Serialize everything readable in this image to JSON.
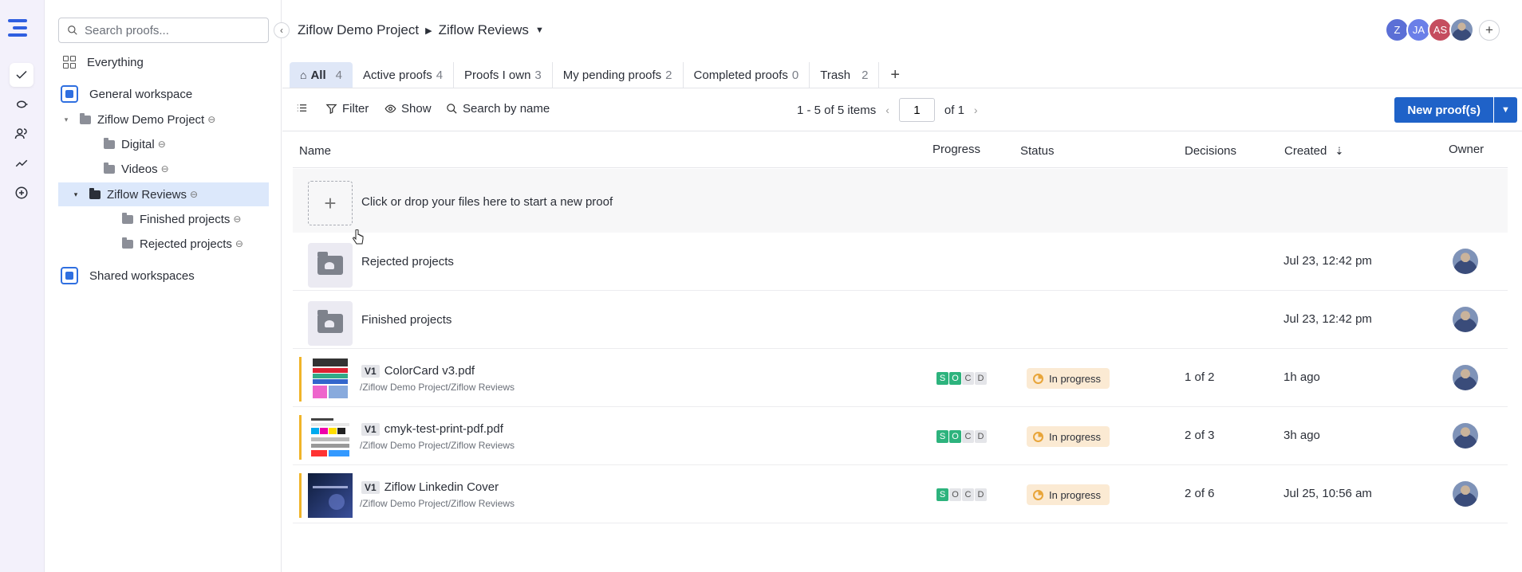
{
  "sidebar": {
    "search_placeholder": "Search proofs...",
    "everything": "Everything",
    "general_workspace": "General workspace",
    "project": "Ziflow Demo Project",
    "folders": [
      "Digital",
      "Videos"
    ],
    "selected_folder": "Ziflow Reviews",
    "subfolders": [
      "Finished projects",
      "Rejected projects"
    ],
    "shared_workspaces": "Shared workspaces"
  },
  "header": {
    "breadcrumb_project": "Ziflow Demo Project",
    "breadcrumb_folder": "Ziflow Reviews",
    "avatars": [
      {
        "initials": "Z",
        "color": "#5b6fd6"
      },
      {
        "initials": "JA",
        "color": "#6b7fe8"
      },
      {
        "initials": "AS",
        "color": "#c54d5f"
      }
    ]
  },
  "tabs": [
    {
      "label": "All",
      "count": "4"
    },
    {
      "label": "Active proofs",
      "count": "4"
    },
    {
      "label": "Proofs I own",
      "count": "3"
    },
    {
      "label": "My pending proofs",
      "count": "2"
    },
    {
      "label": "Completed proofs",
      "count": "0"
    },
    {
      "label": "Trash",
      "count": "2"
    }
  ],
  "toolbar": {
    "filter": "Filter",
    "show": "Show",
    "search": "Search by name",
    "items_range": "1 - 5 of 5 items",
    "page": "1",
    "of_pages": "of 1",
    "new_proof": "New proof(s)"
  },
  "table": {
    "columns": {
      "name": "Name",
      "progress": "Progress",
      "status": "Status",
      "decisions": "Decisions",
      "created": "Created",
      "owner": "Owner"
    },
    "upload_text": "Click or drop your files here to start a new proof",
    "folders": [
      {
        "name": "Rejected projects",
        "created": "Jul 23, 12:42 pm"
      },
      {
        "name": "Finished projects",
        "created": "Jul 23, 12:42 pm"
      }
    ],
    "proofs": [
      {
        "version": "V1",
        "name": "ColorCard v3.pdf",
        "path": "/Ziflow Demo Project/Ziflow Reviews",
        "status": "In progress",
        "decisions": "1 of 2",
        "created": "1h ago",
        "progress": [
          "S",
          "O",
          "C",
          "D"
        ],
        "progress_done": 2
      },
      {
        "version": "V1",
        "name": "cmyk-test-print-pdf.pdf",
        "path": "/Ziflow Demo Project/Ziflow Reviews",
        "status": "In progress",
        "decisions": "2 of 3",
        "created": "3h ago",
        "progress": [
          "S",
          "O",
          "C",
          "D"
        ],
        "progress_done": 2
      },
      {
        "version": "V1",
        "name": "Ziflow Linkedin Cover",
        "path": "/Ziflow Demo Project/Ziflow Reviews",
        "status": "In progress",
        "decisions": "2 of 6",
        "created": "Jul 25, 10:56 am",
        "progress": [
          "S",
          "O",
          "C",
          "D"
        ],
        "progress_done": 1
      }
    ]
  },
  "colors": {
    "accent": "#1f62c8",
    "status_bg": "#fbead3",
    "progress_done": "#2db37d",
    "row_accent": "#f0b429"
  }
}
